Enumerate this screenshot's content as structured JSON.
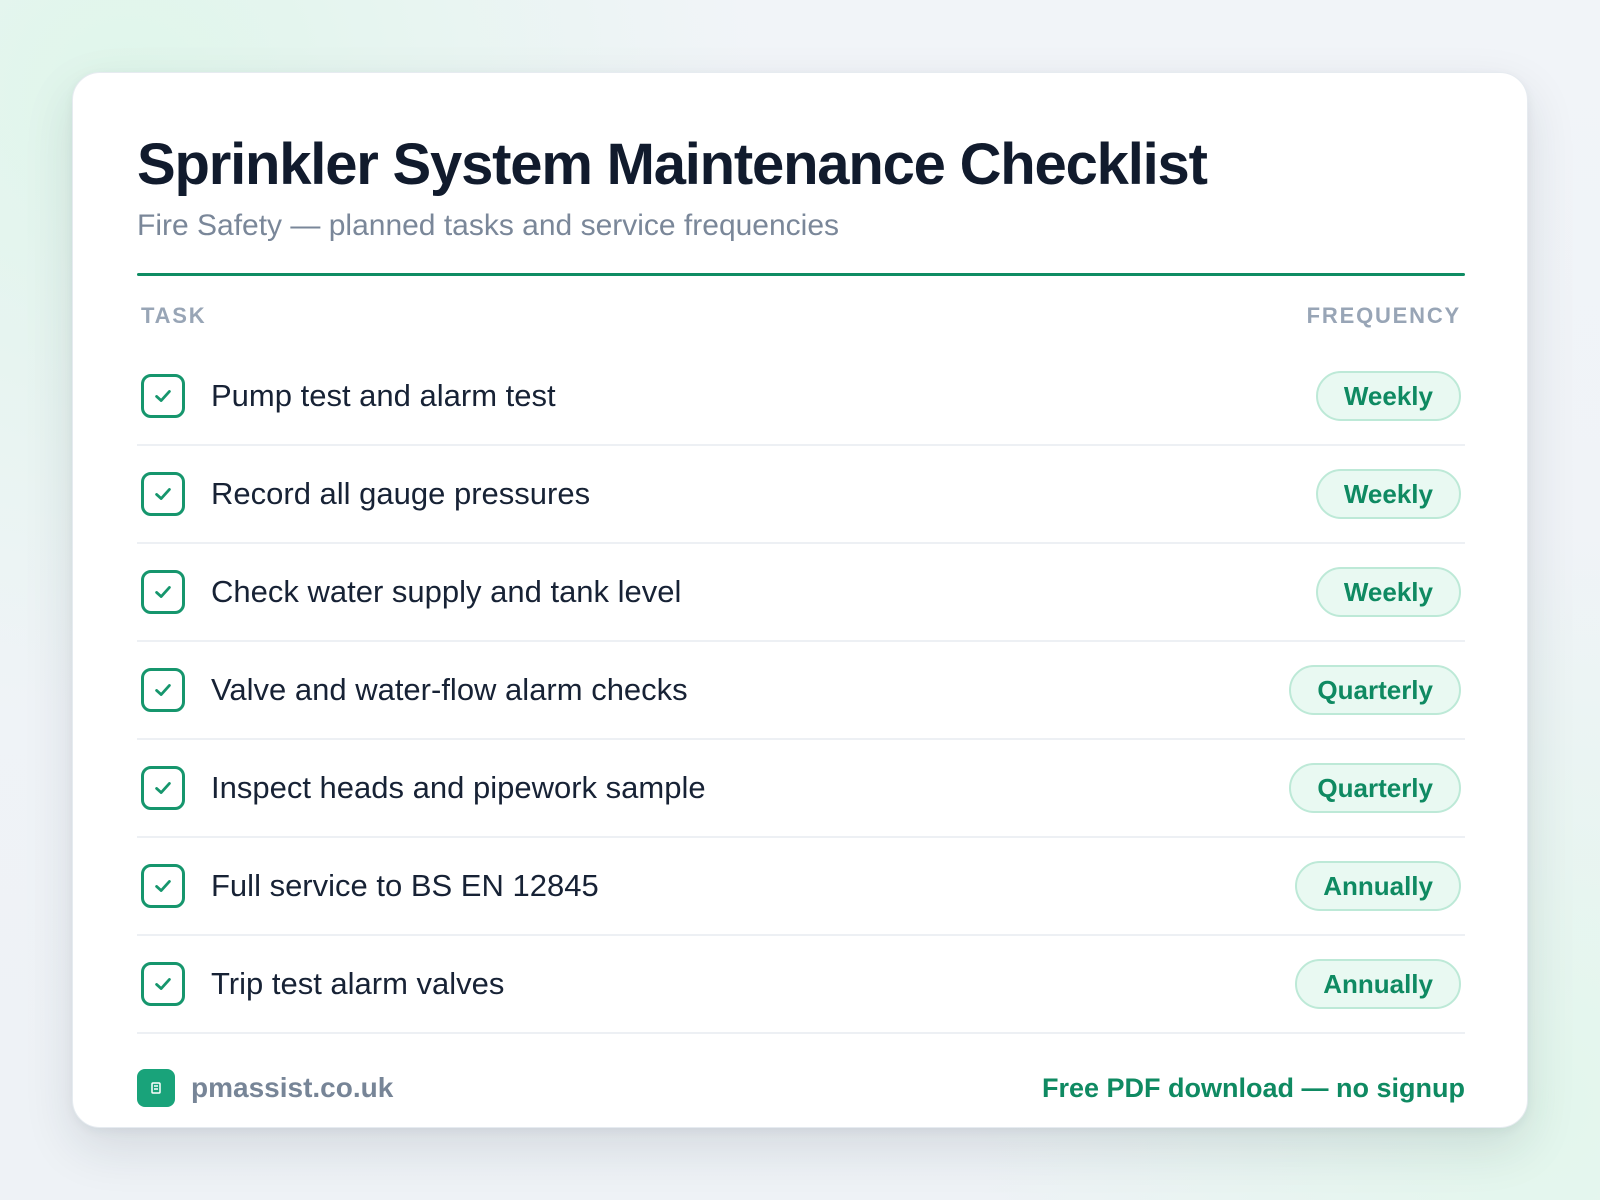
{
  "header": {
    "title": "Sprinkler System Maintenance Checklist",
    "subtitle": "Fire Safety — planned tasks and service frequencies"
  },
  "columns": {
    "task": "TASK",
    "frequency": "FREQUENCY"
  },
  "tasks": [
    {
      "label": "Pump test and alarm test",
      "frequency": "Weekly",
      "checked": true
    },
    {
      "label": "Record all gauge pressures",
      "frequency": "Weekly",
      "checked": true
    },
    {
      "label": "Check water supply and tank level",
      "frequency": "Weekly",
      "checked": true
    },
    {
      "label": "Valve and water-flow alarm checks",
      "frequency": "Quarterly",
      "checked": true
    },
    {
      "label": "Inspect heads and pipework sample",
      "frequency": "Quarterly",
      "checked": true
    },
    {
      "label": "Full service to BS EN 12845",
      "frequency": "Annually",
      "checked": true
    },
    {
      "label": "Trip test alarm valves",
      "frequency": "Annually",
      "checked": true
    }
  ],
  "footer": {
    "brand": "pmassist.co.uk",
    "cta": "Free PDF download — no signup",
    "logo_icon": "building-icon"
  },
  "colors": {
    "accent": "#0e8c63",
    "accent_soft": "#e9f9f2",
    "text_primary": "#172235",
    "text_muted": "#7a8799"
  },
  "icons": {
    "check": "check-icon",
    "checkbox": "checkbox-icon"
  }
}
